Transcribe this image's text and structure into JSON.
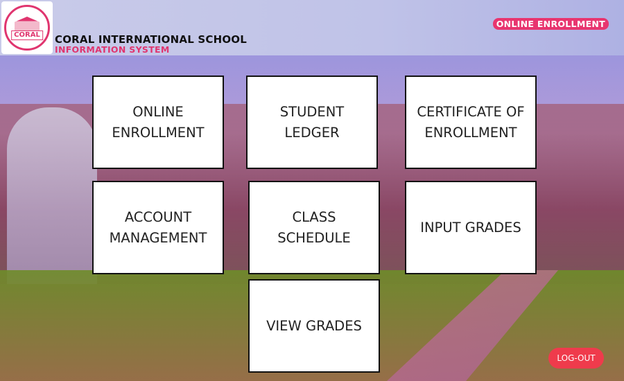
{
  "header": {
    "logo_text": "CORAL",
    "school_name": "CORAL INTERNATIONAL SCHOOL",
    "subtitle": "INFORMATION SYSTEM",
    "badge": "ONLINE ENROLLMENT"
  },
  "tiles": [
    {
      "label": "ONLINE\nENROLLMENT"
    },
    {
      "label": "STUDENT\nLEDGER"
    },
    {
      "label": "CERTIFICATE OF\nENROLLMENT"
    },
    {
      "label": "ACCOUNT\nMANAGEMENT"
    },
    {
      "label": "CLASS\nSCHEDULE"
    },
    {
      "label": "INPUT GRADES"
    },
    {
      "label": "VIEW GRADES"
    }
  ],
  "logout_label": "LOG-OUT",
  "colors": {
    "accent": "#e8356f",
    "logout": "#ef3b4c",
    "header_bg": "#c4c6e8"
  }
}
